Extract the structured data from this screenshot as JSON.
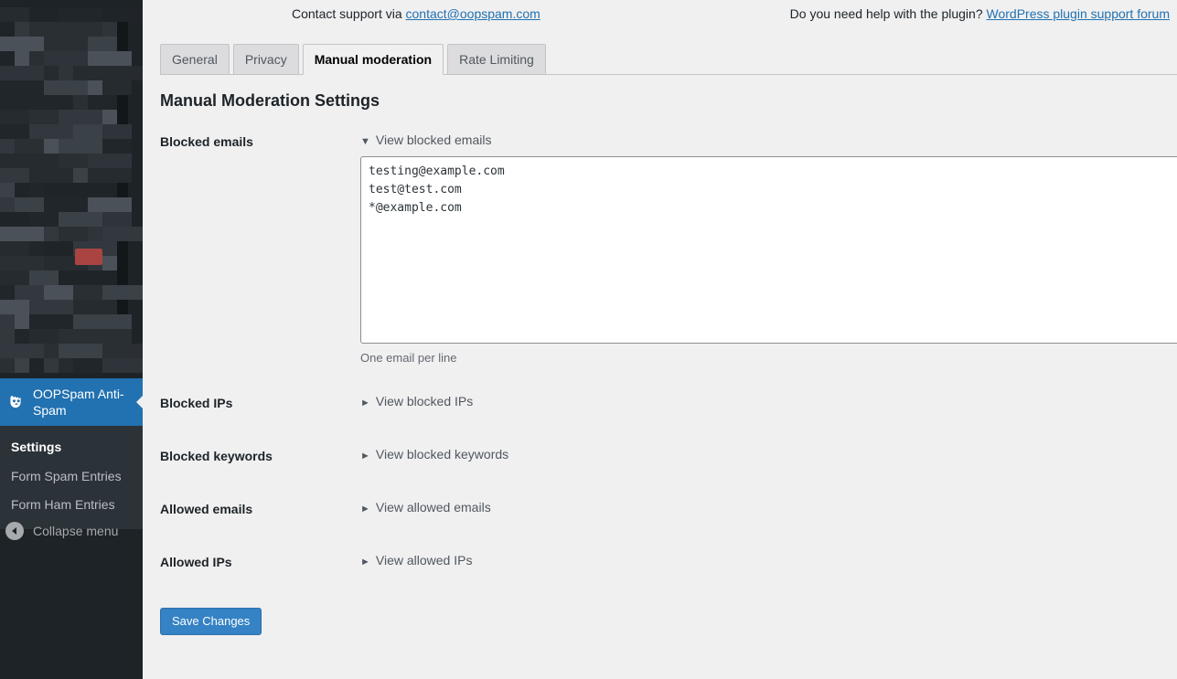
{
  "support_bar": {
    "left_text": "Contact support via ",
    "left_link": "contact@oopspam.com",
    "right_text": "Do you need help with the plugin? ",
    "right_link": "WordPress plugin support forum"
  },
  "tabs": [
    {
      "label": "General",
      "active": false
    },
    {
      "label": "Privacy",
      "active": false
    },
    {
      "label": "Manual moderation",
      "active": true
    },
    {
      "label": "Rate Limiting",
      "active": false
    }
  ],
  "page_title": "Manual Moderation Settings",
  "rows": [
    {
      "label": "Blocked emails",
      "toggle_label": "View blocked emails",
      "triangle": "▼",
      "expanded": true,
      "textarea_value": "testing@example.com\ntest@test.com\n*@example.com",
      "description": "One email per line"
    },
    {
      "label": "Blocked IPs",
      "toggle_label": "View blocked IPs",
      "triangle": "►",
      "expanded": false
    },
    {
      "label": "Blocked keywords",
      "toggle_label": "View blocked keywords",
      "triangle": "►",
      "expanded": false
    },
    {
      "label": "Allowed emails",
      "toggle_label": "View allowed emails",
      "triangle": "►",
      "expanded": false
    },
    {
      "label": "Allowed IPs",
      "toggle_label": "View allowed IPs",
      "triangle": "►",
      "expanded": false
    }
  ],
  "save_button": "Save Changes",
  "sidebar": {
    "plugin_item": "OOPSpam Anti-Spam",
    "submenu": [
      {
        "label": "Settings",
        "current": true
      },
      {
        "label": "Form Spam Entries",
        "current": false
      },
      {
        "label": "Form Ham Entries",
        "current": false
      }
    ],
    "collapse_label": "Collapse menu"
  },
  "colors": {
    "admin_bg": "#f0f0f1",
    "sidebar_bg": "#1d2327",
    "submenu_bg": "#2c3338",
    "accent_blue": "#2271b1",
    "button_blue": "#3582c4",
    "link_blue": "#2271b1",
    "badge_red": "#a94442"
  }
}
